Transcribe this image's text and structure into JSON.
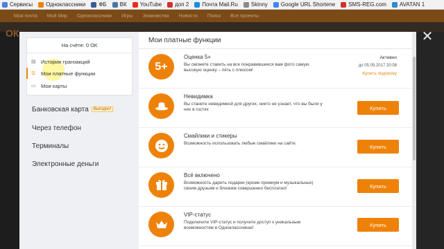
{
  "bookmarks": [
    {
      "label": "Сервисы",
      "icon": "apps-icon",
      "color": "#4a80e0"
    },
    {
      "label": "Одноклассники",
      "icon": "ok-icon",
      "color": "#ee8208"
    },
    {
      "label": "ФБ",
      "icon": "facebook-icon",
      "color": "#3b5998"
    },
    {
      "label": "ВК",
      "icon": "vk-icon",
      "color": "#4c75a3"
    },
    {
      "label": "YouTube",
      "icon": "youtube-icon",
      "color": "#e52d27"
    },
    {
      "label": "доп 2",
      "icon": "red-square-icon",
      "color": "#d32f2f"
    },
    {
      "label": "Почта Mail.Ru",
      "icon": "mail-icon",
      "color": "#168de2"
    },
    {
      "label": "Skinny",
      "icon": "page-icon",
      "color": "#888888"
    },
    {
      "label": "Google URL Shortene",
      "icon": "google-icon",
      "color": "#4285f4"
    },
    {
      "label": "SMS-REG.com",
      "icon": "sms-icon",
      "color": "#d32f2f"
    },
    {
      "label": "AVATAN 1",
      "icon": "avatan-icon",
      "color": "#2d8bd0"
    }
  ],
  "site_bar": {
    "items": [
      "Моя почта",
      "Мой Мир",
      "Одноклассники",
      "Игры",
      "Знакомства",
      "Новости",
      "Поиск",
      "Все проекты"
    ]
  },
  "left": {
    "balance": "На счёте: 0 ОК",
    "menu": [
      {
        "label": "История транзакций",
        "icon": "history-icon"
      },
      {
        "label": "Мои платные функции",
        "icon": "list-icon"
      },
      {
        "label": "Мои карты",
        "icon": "card-icon"
      }
    ],
    "payments": [
      {
        "label": "Банковская карта",
        "badge": "Выгодно!"
      },
      {
        "label": "Через телефон"
      },
      {
        "label": "Терминалы"
      },
      {
        "label": "Электронные деньги"
      }
    ]
  },
  "right": {
    "title": "Мои платные функции",
    "functions": [
      {
        "name": "Оценка 5+",
        "icon_text": "5+",
        "icon": "five-plus-icon",
        "desc": "Вы сможете ставить на все понравившиеся вам фото самую высокую оценку – пять с плюсом!",
        "status": "Активно",
        "date": "до 05.05.2017 20:08",
        "renew": "Купить подписку"
      },
      {
        "name": "Невидимка",
        "icon": "hat-icon",
        "desc": "Вы станете невидимкой для других, никто не узнает, что вы были у них в гостях",
        "buy": "Купить"
      },
      {
        "name": "Смайлики и стикеры",
        "icon": "smile-icon",
        "desc": "Возможность использовать любые смайлики на сайте.",
        "buy": "Купить"
      },
      {
        "name": "Всё включено",
        "icon": "gift-icon",
        "desc": "Возможность дарить подарки (кроме премиум и музыкальных) своим друзьям и близким совершенно бесплатно!",
        "buy": "Купить"
      },
      {
        "name": "VIP-статус",
        "icon": "crown-icon",
        "desc": "Подключите VIP-статус и получите доступ к уникальным возможностям в Одноклассниках!",
        "buy": "Купить"
      }
    ]
  },
  "colors": {
    "accent": "#ee8208"
  }
}
